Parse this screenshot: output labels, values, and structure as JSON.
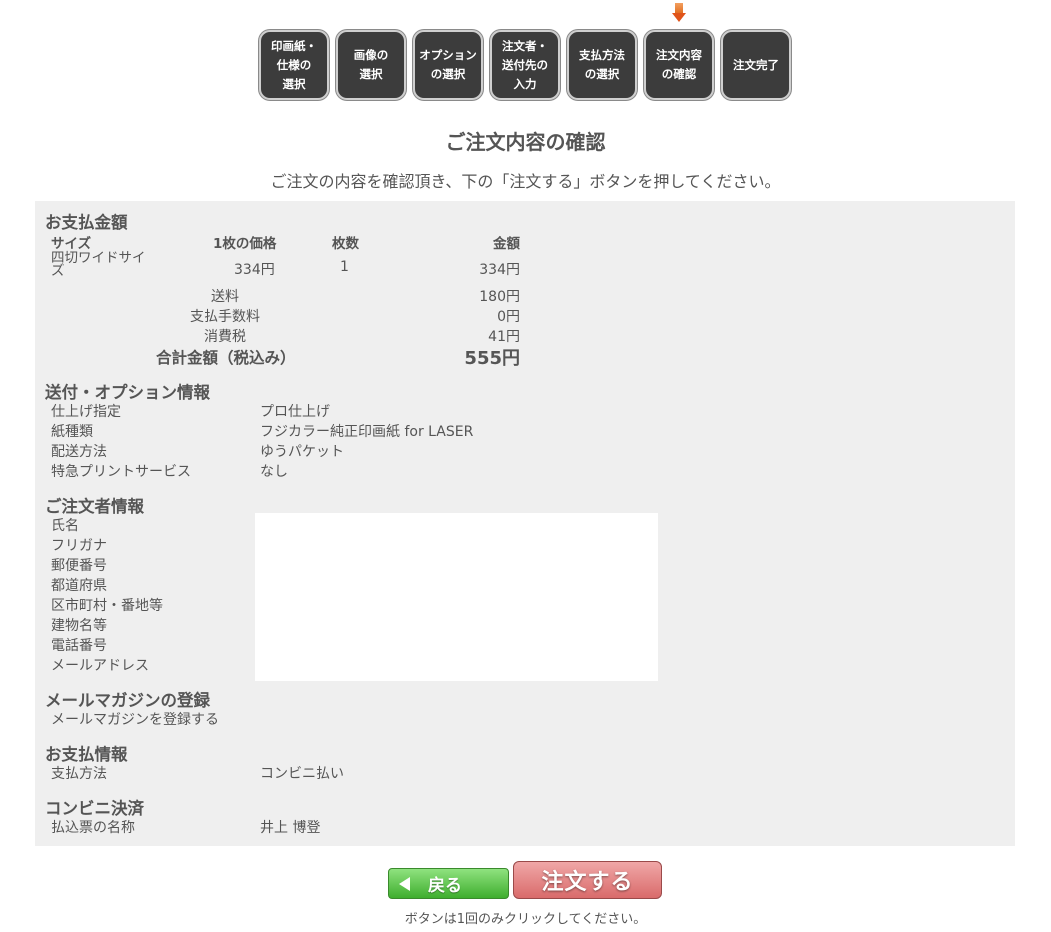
{
  "steps": [
    {
      "label": "印画紙・\n仕様の\n選択"
    },
    {
      "label": "画像の\n選択"
    },
    {
      "label": "オプション\nの選択"
    },
    {
      "label": "注文者・\n送付先の\n入力"
    },
    {
      "label": "支払方法\nの選択"
    },
    {
      "label": "注文内容\nの確認"
    },
    {
      "label": "注文完了"
    }
  ],
  "page": {
    "title": "ご注文内容の確認",
    "intro": "ご注文の内容を確認頂き、下の「注文する」ボタンを押してください。"
  },
  "payment_amount": {
    "section_title": "お支払金額",
    "headers": {
      "size": "サイズ",
      "unit_price": "1枚の価格",
      "quantity": "枚数",
      "amount": "金額"
    },
    "item": {
      "size_line1": "四切ワイドサイ",
      "size_line2": "ズ",
      "unit_price": "334円",
      "quantity": "1",
      "amount": "334円"
    },
    "shipping": {
      "label": "送料",
      "value": "180円"
    },
    "fee": {
      "label": "支払手数料",
      "value": "0円"
    },
    "tax": {
      "label": "消費税",
      "value": "41円"
    },
    "total": {
      "label": "合計金額（税込み）",
      "value": "555円"
    }
  },
  "shipping_options": {
    "section_title": "送付・オプション情報",
    "rows": [
      {
        "label": "仕上げ指定",
        "value": "プロ仕上げ"
      },
      {
        "label": "紙種類",
        "value": "フジカラー純正印画紙 for LASER"
      },
      {
        "label": "配送方法",
        "value": "ゆうパケット"
      },
      {
        "label": "特急プリントサービス",
        "value": "なし"
      }
    ]
  },
  "orderer": {
    "section_title": "ご注文者情報",
    "labels": [
      "氏名",
      "フリガナ",
      "郵便番号",
      "都道府県",
      "区市町村・番地等",
      "建物名等",
      "電話番号",
      "メールアドレス"
    ]
  },
  "newsletter": {
    "section_title": "メールマガジンの登録",
    "label": "メールマガジンを登録する"
  },
  "payment_info": {
    "section_title": "お支払情報",
    "label": "支払方法",
    "value": "コンビニ払い"
  },
  "convenience": {
    "section_title": "コンビニ決済",
    "label": "払込票の名称",
    "value": "井上 博登"
  },
  "buttons": {
    "back": "戻る",
    "order": "注文する",
    "note": "ボタンは1回のみクリックしてください。"
  },
  "colors": {
    "step_bg": "#3c3c3c",
    "panel_bg": "#efefef",
    "back_button": "#4cb83a",
    "order_button": "#e07c7c",
    "current_step_marker": "#e0541a"
  },
  "icons": {
    "current_step_marker": "down-arrow-icon",
    "back": "left-triangle-icon"
  }
}
